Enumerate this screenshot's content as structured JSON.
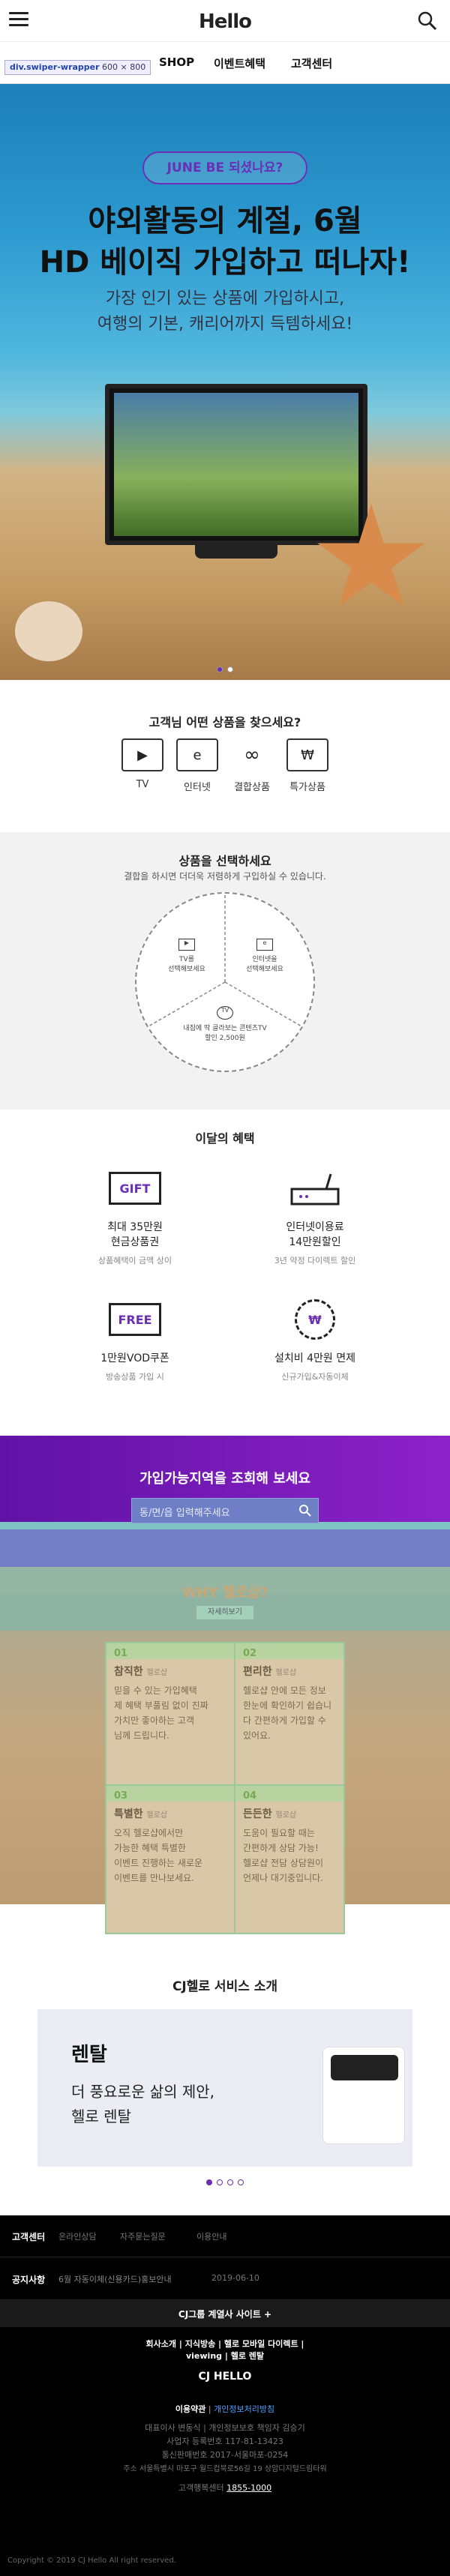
{
  "header": {
    "logo": "Hello",
    "tooltip_name": "div.swiper-wrapper",
    "tooltip_size": "600 × 800"
  },
  "gnb": {
    "items": [
      "SHOP",
      "이벤트혜택",
      "고객센터"
    ]
  },
  "hero": {
    "pill": "JUNE BE 되셨나요?",
    "title1": "야외활동의 계절, 6월",
    "title2": "HD 베이직 가입하고 떠나자!",
    "sub1": "가장 인기 있는 상품에 가입하시고,",
    "sub2": "여행의 기본, 캐리어까지 득템하세요!"
  },
  "category": {
    "title": "고객님 어떤 상품을 찾으세요?",
    "items": [
      {
        "icon": "▶",
        "label": "TV"
      },
      {
        "icon": "e",
        "label": "인터넷"
      },
      {
        "icon": "∞",
        "label": "결합상품"
      },
      {
        "icon": "₩",
        "label": "특가상품"
      }
    ]
  },
  "select": {
    "title": "상품을 선택하세요",
    "sub": "결합을 하시면 더더욱 저렴하게 구입하실 수 있습니다.",
    "tv": "TV를\n선택해보세요",
    "internet": "인터넷을\n선택해보세요",
    "combo": "내집에 딱 골라보는 콘텐츠TV\n할인 2,500원"
  },
  "benefit": {
    "title": "이달의 혜택",
    "items": [
      {
        "badge": "GIFT",
        "t1": "최대 35만원",
        "t2": "현금상품권",
        "s": "상품혜택이 금액 상이"
      },
      {
        "badge": "",
        "t1": "인터넷이용료",
        "t2": "14만원할인",
        "s": "3년 약정 다이렉트 할인"
      },
      {
        "badge": "FREE",
        "t1": "1만원VOD쿠폰",
        "t2": "",
        "s": "방송상품 가입 시"
      },
      {
        "badge": "₩",
        "t1": "설치비 4만원 면제",
        "t2": "",
        "s": "신규가입&자동이체"
      }
    ]
  },
  "area": {
    "title": "가입가능지역을 조회해 보세요",
    "placeholder": "동/면/읍 입력해주세요"
  },
  "why": {
    "title": "WHY 헬로샵?",
    "more": "자세히보기",
    "cards": [
      {
        "n": "01",
        "h": "참직한",
        "sub": "헬로샵",
        "b": [
          "믿을 수 있는 가입혜택",
          "제 혜택 부풀림 없이 진짜",
          "가치만 좋아하는 고객",
          "님께 드립니다."
        ]
      },
      {
        "n": "02",
        "h": "편리한",
        "sub": "헬로샵",
        "b": [
          "헬로샵 안에 모든 정보",
          "한눈에 확인하기 쉽습니",
          "다 간편하게 가입할 수",
          "있어요."
        ]
      },
      {
        "n": "03",
        "h": "특별한",
        "sub": "헬로샵",
        "b": [
          "오직 헬로샵에서만",
          "가능한 혜택 특별한",
          "이벤트 진행하는 새로운",
          "이벤트를 만나보세요."
        ]
      },
      {
        "n": "04",
        "h": "든든한",
        "sub": "헬로샵",
        "b": [
          "도움이 필요할 때는",
          "간편하게 상담 가능!",
          "헬로샵 전담 상담원이",
          "언제나 대기중입니다."
        ]
      }
    ]
  },
  "service": {
    "title": "CJ헬로 서비스 소개",
    "heading": "렌탈",
    "body1": "더 풍요로운 삶의 제안,",
    "body2": "헬로 렌탈"
  },
  "footer": {
    "cs_label": "고객센터",
    "cs_items": [
      "온라인상담",
      "자주묻는질문",
      "이용안내"
    ],
    "notice_label": "공지사항",
    "notice_text": "6월 자동이체(신용카드)홍보안내",
    "notice_date": "2019-06-10",
    "family": "CJ그룹 계열사 사이트",
    "links1": "회사소개 | 지식방송 | 헬로 모바일 다이렉트 |",
    "links2": "viewing | 헬로 렌탈",
    "logo": "CJ HELLO",
    "terms": "이용약관",
    "privacy": "개인정보처리방침",
    "info1": "대표이사 변동식 | 개인정보보호 책임자 김승기",
    "info2": "사업자 등록번호 117-81-13423",
    "info3": "통신판매번호 2017-서울마포-0254",
    "info4": "주소 서울특별시 마포구 월드컵북로56길 19 상암디지털드림타워",
    "tel_label": "고객행복센터",
    "tel": "1855-1000",
    "copyright": "Copyright © 2019 CJ Hello All right reserved."
  },
  "colors": {
    "purple": "#6a2fb5",
    "footer_bg": "#000000"
  }
}
